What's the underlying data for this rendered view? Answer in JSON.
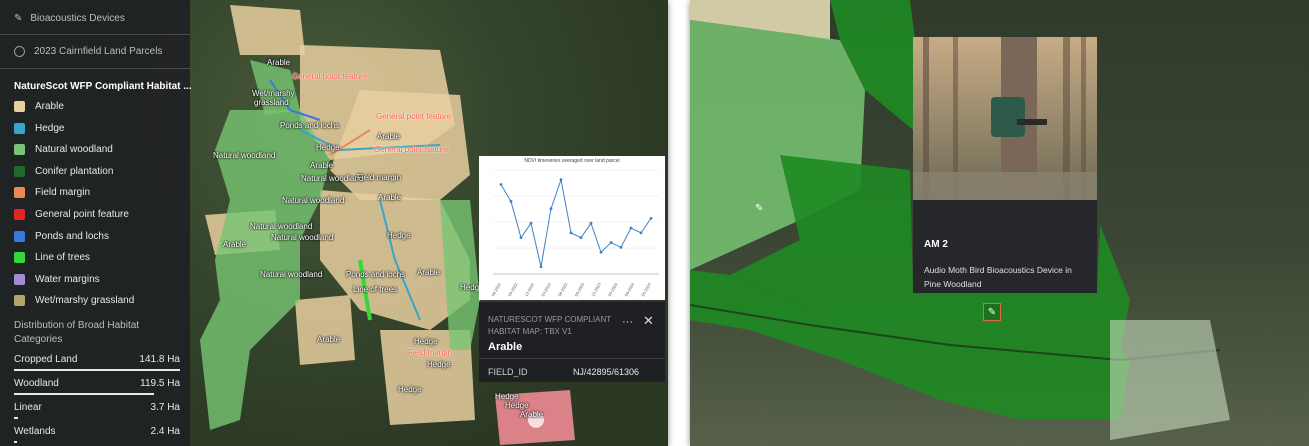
{
  "sidebar": {
    "layer1": "Bioacoustics Devices",
    "layer2": "2023 Cairnfield Land Parcels",
    "category_title": "NatureScot WFP Compliant Habitat ...",
    "categories": [
      {
        "label": "Arable",
        "color": "#e7cfa0"
      },
      {
        "label": "Hedge",
        "color": "#3aa5c7"
      },
      {
        "label": "Natural woodland",
        "color": "#78c573"
      },
      {
        "label": "Conifer plantation",
        "color": "#1f6a2a"
      },
      {
        "label": "Field margin",
        "color": "#e88a58"
      },
      {
        "label": "General point feature",
        "color": "#e12626"
      },
      {
        "label": "Ponds and lochs",
        "color": "#3a7ae0"
      },
      {
        "label": "Line of trees",
        "color": "#35d83a"
      },
      {
        "label": "Water margins",
        "color": "#a68ad6"
      },
      {
        "label": "Wet/marshy grassland",
        "color": "#b3a36e"
      }
    ],
    "distribution_title": "Distribution of Broad Habitat Categories",
    "distribution": [
      {
        "label": "Cropped Land",
        "value": "141.8 Ha",
        "fraction": 1.0
      },
      {
        "label": "Woodland",
        "value": "119.5 Ha",
        "fraction": 0.843
      },
      {
        "label": "Linear",
        "value": "3.7 Ha",
        "fraction": 0.026
      },
      {
        "label": "Wetlands",
        "value": "2.4 Ha",
        "fraction": 0.017
      }
    ]
  },
  "map_labels": {
    "arable": "Arable",
    "general_point_feature": "General point feature",
    "general_point_nature": "General point Nature",
    "wet_marshy": "Wet/marshy",
    "grassland": "grassland",
    "ponds_and_lochs": "Ponds and lochs",
    "hedge": "Hedge",
    "natural_woodland": "Natural woodland",
    "field_margin": "Field margin",
    "line_of_trees": "Line of trees"
  },
  "chart_popup": {
    "title": "NDVI timeseries averaged over land parcel",
    "chart_data": {
      "type": "line",
      "title": "NDVI timeseries averaged over land parcel",
      "categories": [
        "06-2022",
        "09-2022",
        "12-2022",
        "03-2023",
        "06-2023",
        "09-2023",
        "12-2023",
        "03-2024",
        "06-2024",
        "09-2024"
      ],
      "series": [
        {
          "values": [
            0.62,
            0.55,
            0.4,
            0.46,
            0.28,
            0.52,
            0.64,
            0.42,
            0.4,
            0.46,
            0.34,
            0.38,
            0.36,
            0.44,
            0.42,
            0.48
          ]
        }
      ],
      "grid": true
    }
  },
  "feature_popup": {
    "title": "NATURESCOT WFP COMPLIANT HABITAT MAP: TBX V1",
    "name": "Arable",
    "field_key": "FIELD_ID",
    "field_value": "NJ/42895/61306",
    "more": "···",
    "close": "✕"
  },
  "device_card": {
    "title": "AM 2",
    "description": "Audio Moth Bird Bioacoustics Device in Pine Woodland"
  }
}
